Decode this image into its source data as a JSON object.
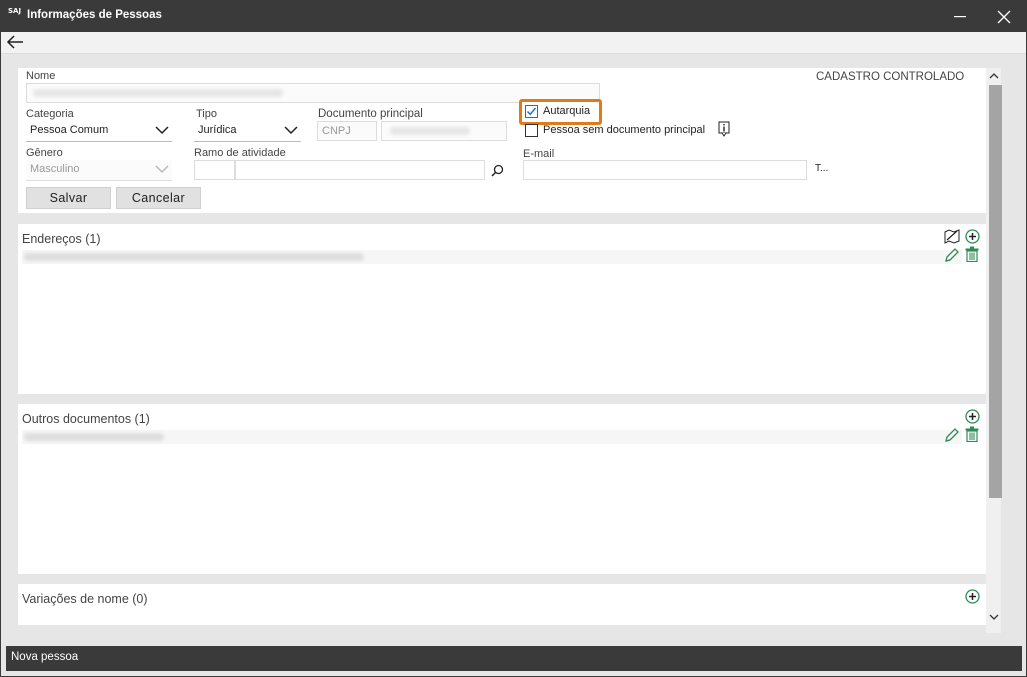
{
  "titlebar": {
    "logo": "SAJ",
    "title": "Informações de Pessoas"
  },
  "form": {
    "nome_label": "Nome",
    "controlado": "CADASTRO CONTROLADO",
    "categoria_label": "Categoria",
    "categoria_value": "Pessoa Comum",
    "tipo_label": "Tipo",
    "tipo_value": "Jurídica",
    "documento_label": "Documento principal",
    "documento_tipo": "CNPJ",
    "autarquia_label": "Autarquia",
    "sem_documento_label": "Pessoa sem documento principal",
    "genero_label": "Gênero",
    "genero_value": "Masculino",
    "ramo_label": "Ramo de atividade",
    "email_label": "E-mail",
    "email_extra": "T...",
    "salvar": "Salvar",
    "cancelar": "Cancelar"
  },
  "sections": {
    "enderecos": "Endereços (1)",
    "outros_documentos": "Outros documentos (1)",
    "variacoes": "Variações de nome (0)"
  },
  "status": {
    "text": "Nova pessoa"
  },
  "colors": {
    "titlebar": "#3a3a3a",
    "highlight": "#e07b17",
    "accent_green": "#2e8b57",
    "check_blue": "#1a6fc9"
  }
}
